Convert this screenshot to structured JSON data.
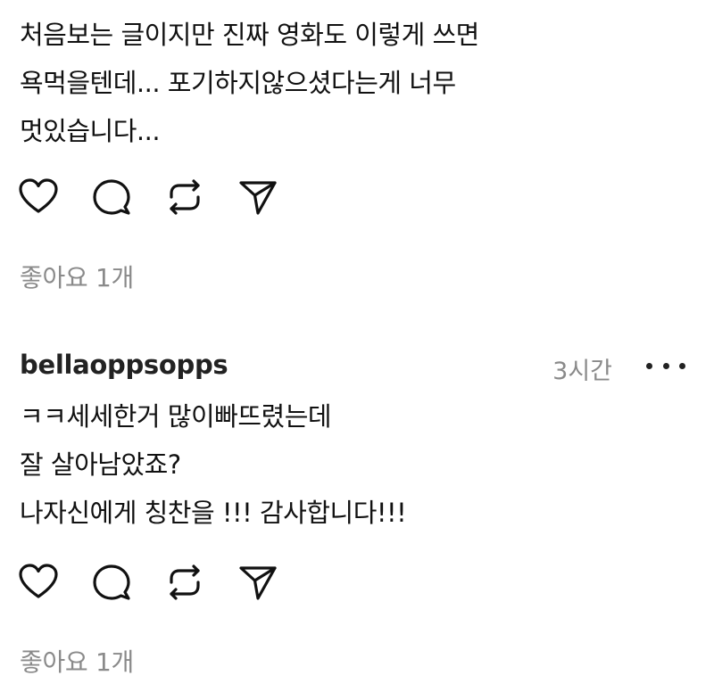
{
  "posts": [
    {
      "username": "",
      "timestamp": "",
      "lines": [
        "처음보는 글이지만 진짜 영화도 이렇게 쓰면",
        "욕먹을텐데... 포기하지않으셨다는게 너무",
        "멋있습니다..."
      ],
      "likes_label": "좋아요 1개"
    },
    {
      "username": "bellaoppsopps",
      "timestamp": "3시간",
      "lines": [
        "ㅋㅋ세세한거 많이빠뜨렸는데",
        "잘 살아남았죠?",
        "나자신에게 칭찬을 !!! 감사합니다!!!"
      ],
      "likes_label": "좋아요 1개"
    }
  ],
  "icons": {
    "like": "heart-icon",
    "reply": "speech-bubble-icon",
    "repost": "repost-icon",
    "share": "send-icon",
    "more": "more-horizontal-icon"
  }
}
